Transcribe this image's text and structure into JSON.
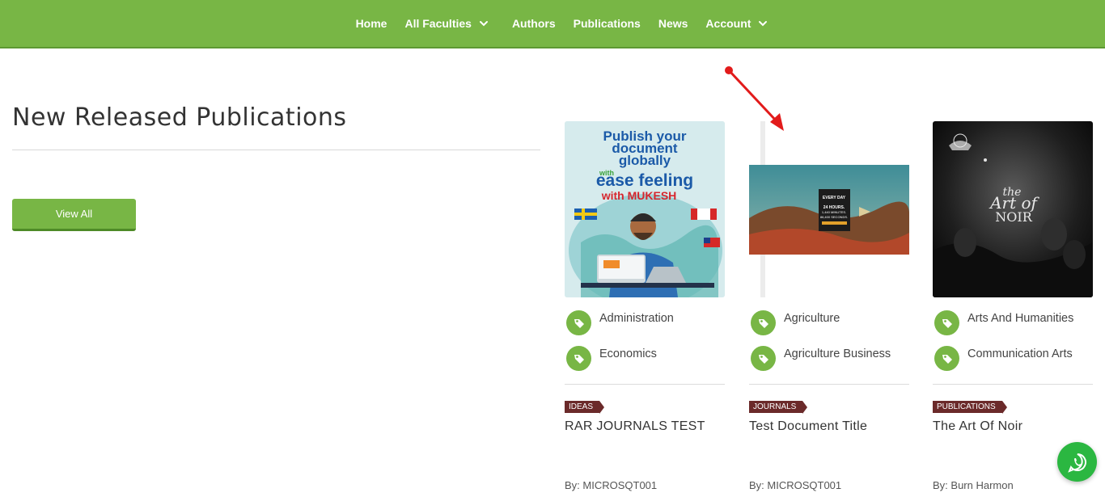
{
  "nav": {
    "items": [
      {
        "label": "Home"
      },
      {
        "label": "All Faculties",
        "has_dropdown": true
      },
      {
        "label": "Authors"
      },
      {
        "label": "Publications"
      },
      {
        "label": "News"
      },
      {
        "label": "Account",
        "has_dropdown": true
      }
    ]
  },
  "section": {
    "heading": "New Released Publications",
    "view_all_label": "View All"
  },
  "cards": [
    {
      "cover_text": [
        "Publish your",
        "document",
        "globally",
        "with",
        "ease feeling",
        "with MUKESH"
      ],
      "tags": [
        "Administration",
        "Economics"
      ],
      "category": "IDEAS",
      "title": "RAR JOURNALS TEST",
      "author": "By: MICROSQT001"
    },
    {
      "cover_text": [
        "EVERY DAY",
        "24 HOURS.",
        "1,440 MINUTES.",
        "86,400 SECONDS."
      ],
      "tags": [
        "Agriculture",
        "Agriculture Business"
      ],
      "category": "JOURNALS",
      "title": "Test Document Title",
      "author": "By: MICROSQT001"
    },
    {
      "cover_text": [
        "the",
        "Art of",
        "NOIR"
      ],
      "tags": [
        "Arts And Humanities",
        "Communication Arts"
      ],
      "category": "PUBLICATIONS",
      "title": "The Art Of Noir",
      "author": "By: Burn Harmon"
    }
  ],
  "colors": {
    "brand_green": "#78b645",
    "category_badge": "#6b2a2a",
    "annotation_arrow": "#e21b1b",
    "whatsapp": "#2bb741"
  },
  "icons": {
    "nav_dropdown": "chevron-down-icon",
    "tag": "tag-icon",
    "floating": "whatsapp-icon"
  }
}
